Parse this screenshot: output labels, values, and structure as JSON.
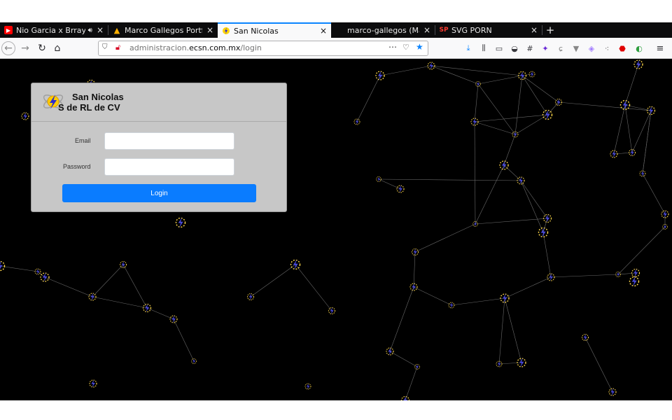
{
  "browser": {
    "tabs": [
      {
        "title": "Nio Garcia x Brray x J",
        "favicon": "youtube-icon",
        "audio": true
      },
      {
        "title": "Marco Gallegos Portfolio",
        "favicon": "warning-triangle-icon"
      },
      {
        "title": "San Nicolas",
        "favicon": "san-nicolas-logo-icon",
        "active": true
      },
      {
        "title": "marco-gallegos (Marco A",
        "favicon": "github-icon"
      },
      {
        "title": "SVG PORN",
        "favicon": "sp-icon"
      }
    ],
    "url": {
      "prefix": "administracion.",
      "domain": "ecsn.com.mx",
      "path": "/login"
    },
    "accent_color": "#0a84ff"
  },
  "login": {
    "company_line1": "San Nicolas",
    "company_line2": "S de RL de CV",
    "email_label": "Email",
    "email_value": "",
    "password_label": "Password",
    "password_value": "",
    "submit_label": "Login",
    "button_color": "#0a7cff"
  },
  "background": {
    "color": "#000000",
    "node_icon": "lightning-atom-icon",
    "edge_color": "#6a6a6a"
  }
}
